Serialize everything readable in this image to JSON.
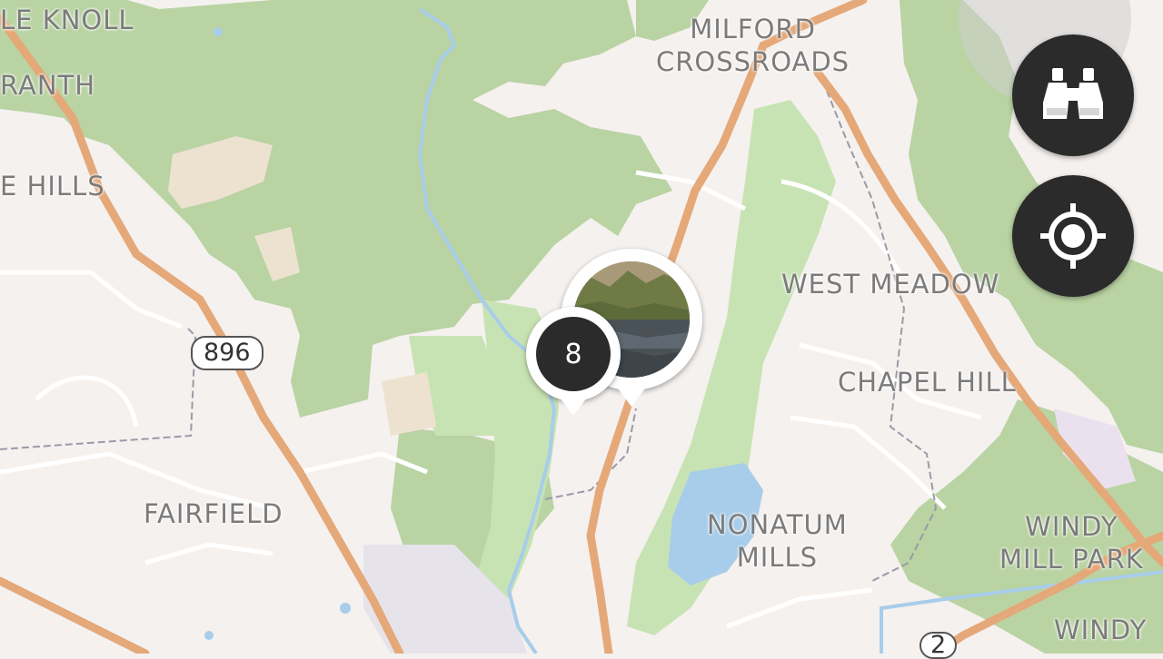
{
  "map": {
    "colors": {
      "land": "#f5f1ef",
      "forest": "#b9d3a3",
      "park": "#c8e3b3",
      "tan": "#ede2d0",
      "road_major": "#e5a878",
      "water": "#a8cdea",
      "industrial": "#e6e4ea",
      "accent": "#2a8f93"
    },
    "place_labels": [
      {
        "id": "le-knoll",
        "text": "LE KNOLL"
      },
      {
        "id": "ranth",
        "text": "RANTH"
      },
      {
        "id": "e-hills",
        "text": "E HILLS"
      },
      {
        "id": "milford-crossroads",
        "line1": "MILFORD",
        "line2": "CROSSROADS"
      },
      {
        "id": "west-meadow",
        "text": "WEST MEADOW"
      },
      {
        "id": "chapel-hill",
        "text": "CHAPEL HILL"
      },
      {
        "id": "fairfield",
        "text": "FAIRFIELD"
      },
      {
        "id": "nonatum-mills",
        "line1": "NONATUM",
        "line2": "MILLS"
      },
      {
        "id": "windy-mill-park",
        "line1": "WINDY",
        "line2": "MILL PARK"
      },
      {
        "id": "windy-bottom",
        "text": "WINDY"
      }
    ],
    "route_shields": [
      {
        "id": "route-896",
        "text": "896"
      },
      {
        "id": "route-2",
        "text": "2"
      }
    ],
    "markers": {
      "cluster_count": "8",
      "photo_marker": "photo-thumbnail-marker"
    }
  },
  "controls": {
    "explore_icon": "binoculars-icon",
    "locate_icon": "crosshair-locate-icon"
  }
}
